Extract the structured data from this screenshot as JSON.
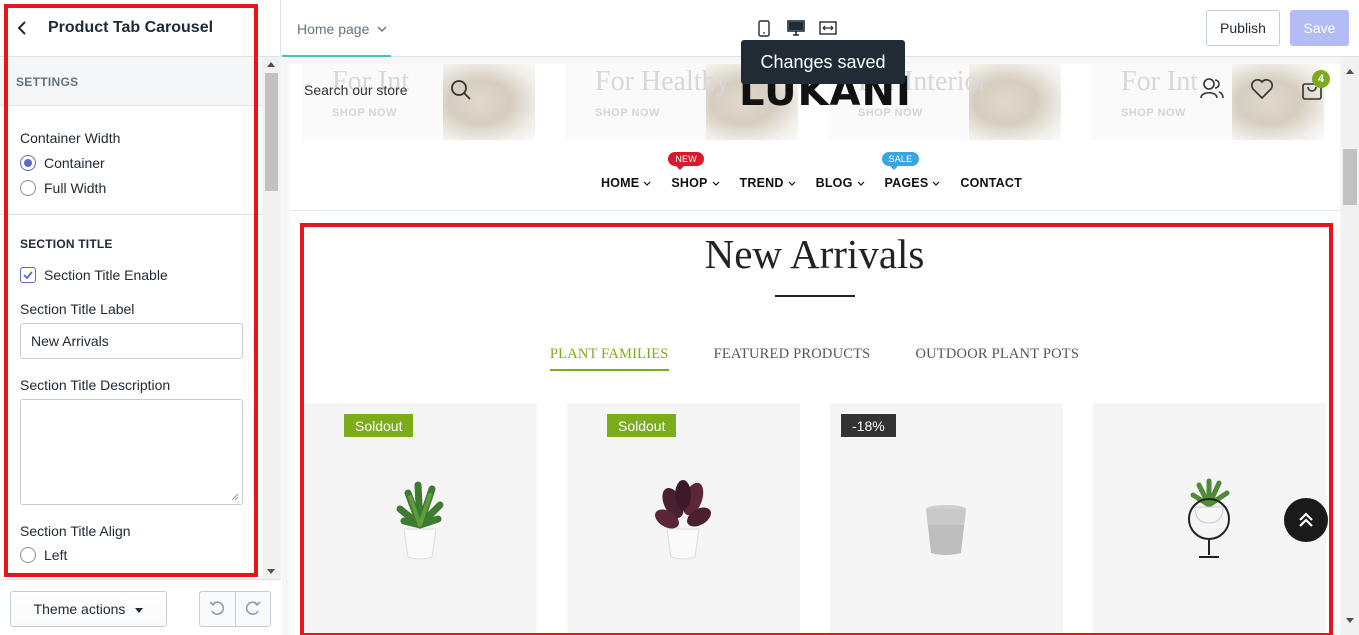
{
  "panel": {
    "title": "Product Tab Carousel",
    "settings_heading": "SETTINGS",
    "container_width": {
      "label": "Container Width",
      "options": [
        "Container",
        "Full Width"
      ],
      "selected": "Container"
    },
    "section_title": {
      "heading": "SECTION TITLE",
      "enable_label": "Section Title Enable",
      "enabled": true,
      "label_field": {
        "label": "Section Title Label",
        "value": "New Arrivals"
      },
      "description_field": {
        "label": "Section Title Description",
        "value": ""
      },
      "align": {
        "label": "Section Title Align",
        "options": [
          "Left"
        ],
        "selected": ""
      }
    },
    "footer": {
      "theme_actions": "Theme actions"
    }
  },
  "topbar": {
    "page": "Home page",
    "publish": "Publish",
    "save": "Save",
    "view_icons": [
      "mobile-icon",
      "desktop-icon",
      "fullwidth-icon"
    ]
  },
  "toast": "Changes saved",
  "store": {
    "search_placeholder": "Search our store",
    "logo": "LUKANI",
    "cart_count": "4",
    "banners": [
      {
        "title": "For Int",
        "cta": "SHOP NOW"
      },
      {
        "title": "For Healthy",
        "cta": "SHOP NOW"
      },
      {
        "title": "For Interior",
        "cta": "SHOP NOW"
      },
      {
        "title": "For Int",
        "cta": "SHOP NOW"
      }
    ],
    "nav": [
      {
        "label": "HOME",
        "dropdown": true,
        "badge": ""
      },
      {
        "label": "SHOP",
        "dropdown": true,
        "badge": "NEW"
      },
      {
        "label": "TREND",
        "dropdown": true,
        "badge": ""
      },
      {
        "label": "BLOG",
        "dropdown": true,
        "badge": ""
      },
      {
        "label": "PAGES",
        "dropdown": true,
        "badge": "SALE"
      },
      {
        "label": "CONTACT",
        "dropdown": false,
        "badge": ""
      }
    ],
    "section": {
      "title": "New Arrivals",
      "tabs": [
        "PLANT FAMILIES",
        "FEATURED PRODUCTS",
        "OUTDOOR PLANT POTS"
      ],
      "active_tab": "PLANT FAMILIES",
      "products": [
        {
          "badge": "Soldout",
          "image": "green-plant-in-white-pot"
        },
        {
          "badge": "Soldout",
          "image": "purple-plant-in-white-pot"
        },
        {
          "badge": "-18%",
          "image": "grey-concrete-pot"
        },
        {
          "badge": "",
          "image": "succulent-in-hanging-planter"
        }
      ]
    }
  },
  "colors": {
    "accent_green": "#7bac1c",
    "highlight_red": "#e8141a",
    "save_disabled": "#b3bcf5",
    "radio_selected": "#5c6ac4"
  }
}
